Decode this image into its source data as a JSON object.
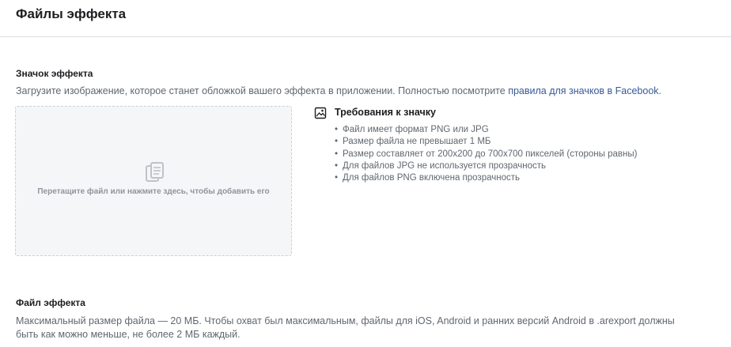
{
  "header": {
    "title": "Файлы эффекта"
  },
  "icon_section": {
    "title": "Значок эффекта",
    "description_prefix": "Загрузите изображение, которое станет обложкой вашего эффекта в приложении. Полностью посмотрите ",
    "description_link": "правила для значков в Facebook",
    "description_suffix": ".",
    "dropzone": {
      "icon": "document-stack-icon",
      "text": "Перетащите файл или нажмите здесь, чтобы добавить его"
    },
    "requirements": {
      "icon": "image-icon",
      "title": "Требования к значку",
      "items": [
        "Файл имеет формат PNG или JPG",
        "Размер файла не превышает 1 МБ",
        "Размер составляет от 200x200 до 700x700 пикселей (стороны равны)",
        "Для файлов JPG не используется прозрачность",
        "Для файлов PNG включена прозрачность"
      ]
    }
  },
  "file_section": {
    "title": "Файл эффекта",
    "description_line1": "Максимальный размер файла — 20 МБ. Чтобы охват был максимальным, файлы для iOS, Android и ранних версий Android в .arexport должны",
    "description_line2": "быть как можно меньше, не более 2 МБ каждый."
  },
  "colors": {
    "link": "#385898",
    "text_secondary": "#606770",
    "dropzone_bg": "#f5f6f7"
  }
}
